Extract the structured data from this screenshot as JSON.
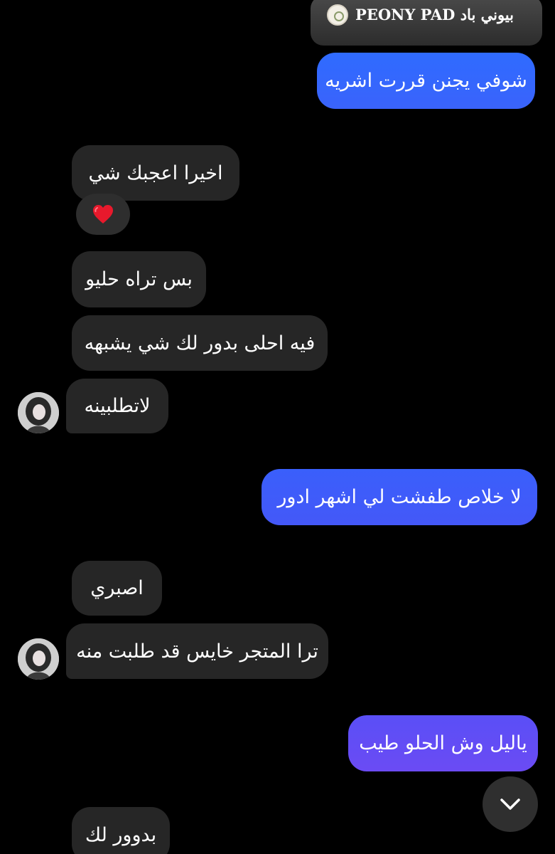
{
  "shared_post": {
    "title": "بيوني باد PEONY PAD"
  },
  "messages": [
    {
      "id": "m1",
      "sender": "me",
      "text": "شوفي يجنن قررت اشريه"
    },
    {
      "id": "m2",
      "sender": "them",
      "text": "اخيرا اعجبك شي",
      "reaction": "❤️"
    },
    {
      "id": "m3",
      "sender": "them",
      "text": "بس تراه حليو"
    },
    {
      "id": "m4",
      "sender": "them",
      "text": "فيه احلى بدور لك شي يشبهه"
    },
    {
      "id": "m5",
      "sender": "them",
      "text": "لاتطلبينه"
    },
    {
      "id": "m6",
      "sender": "me",
      "text": "لا خلاص طفشت لي اشهر ادور"
    },
    {
      "id": "m7",
      "sender": "them",
      "text": "اصبري"
    },
    {
      "id": "m8",
      "sender": "them",
      "text": "ترا المتجر خايس قد طلبت منه"
    },
    {
      "id": "m9",
      "sender": "me",
      "text": "ياليل وش الحلو طيب"
    },
    {
      "id": "m10",
      "sender": "them",
      "text": "بدوور لك"
    }
  ],
  "colors": {
    "background": "#000000",
    "incoming_bubble": "#262626",
    "outgoing_gradient_top": "#2f6bff",
    "outgoing_gradient_bottom": "#6a4cf5"
  },
  "icons": {
    "scroll_down": "chevron-down-icon",
    "reaction": "red-heart-emoji"
  }
}
